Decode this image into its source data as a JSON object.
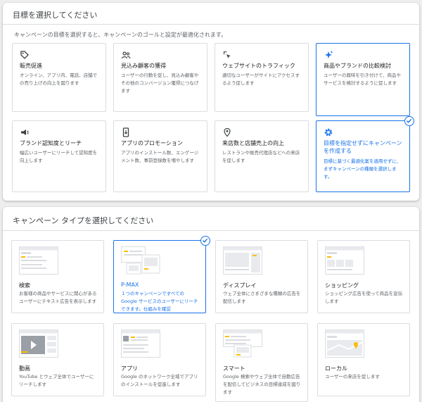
{
  "goal_section": {
    "title": "目標を選択してください",
    "subtitle": "キャンペーンの目標を選択すると、キャンペーンのゴールと設定が最適化されます。",
    "cards": [
      {
        "icon": "tag-icon",
        "label": "販売促進",
        "desc": "オンライン、アプリ内、電話、店舗での売り上げの向上を図ります"
      },
      {
        "icon": "people-icon",
        "label": "見込み顧客の獲得",
        "desc": "ユーザーの行動を促し、見込み顧客やその他のコンバージョン獲得につなげます"
      },
      {
        "icon": "cursor-click-icon",
        "label": "ウェブサイトのトラフィック",
        "desc": "適切なユーザーがサイトにアクセスするよう促します"
      },
      {
        "icon": "sparkle-icon",
        "label": "商品やブランドの比較検討",
        "desc": "ユーザーの興味を引き付けて、商品やサービスを検討するように促します"
      },
      {
        "icon": "megaphone-icon",
        "label": "ブランド認知度とリーチ",
        "desc": "幅広いユーザーにリーチして認知度を向上します"
      },
      {
        "icon": "phone-icon",
        "label": "アプリのプロモーション",
        "desc": "アプリのインストール数、エンゲージメント数、事前登録数を増やします"
      },
      {
        "icon": "location-pin-icon",
        "label": "来店数と店舗売上の向上",
        "desc": "レストランや販売代理店などへの来店を促します"
      },
      {
        "icon": "gear-icon",
        "label": "目標を指定せずにキャンペーンを作成する",
        "desc": "目標に基づく最適化案を適用せずに、まずキャンペーンの種類を選択します。"
      }
    ]
  },
  "type_section": {
    "title": "キャンペーン タイプを選択してください",
    "cards": [
      {
        "thumb": "search-thumb",
        "label": "検索",
        "desc": "お客様の商品やサービスに関心があるユーザーにテキスト広告を表示します"
      },
      {
        "thumb": "pmax-thumb",
        "label": "P-MAX",
        "desc": "１つのキャンペーンですべての Google サービスのユーザーにリーチできます。仕組みを確認"
      },
      {
        "thumb": "display-thumb",
        "label": "ディスプレイ",
        "desc": "ウェブ全体にさまざまな種類の広告を配信します"
      },
      {
        "thumb": "shopping-thumb",
        "label": "ショッピング",
        "desc": "ショッピング広告を使って商品を宣伝します"
      },
      {
        "thumb": "video-thumb",
        "label": "動画",
        "desc": "YouTube とウェブ全体でユーザーにリーチします"
      },
      {
        "thumb": "app-thumb",
        "label": "アプリ",
        "desc": "Google のネットワーク全域でアプリのインストールを促進します"
      },
      {
        "thumb": "smart-thumb",
        "label": "スマート",
        "desc": "Google 検索やウェブ全体で自動広告を配信してビジネスの目標達成を図ります"
      },
      {
        "thumb": "local-thumb",
        "label": "ローカル",
        "desc": "ユーザーの来店を促します"
      }
    ]
  },
  "colors": {
    "accent": "#1a73e8",
    "yellow": "#fbbc04",
    "gray": "#dadce0"
  }
}
